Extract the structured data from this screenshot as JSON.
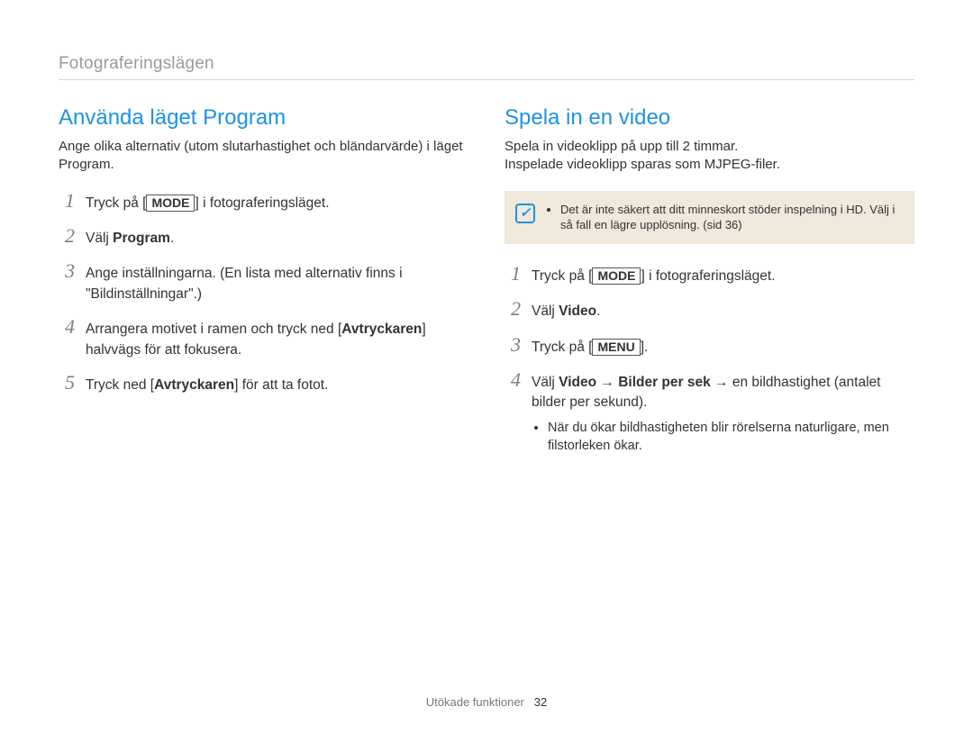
{
  "breadcrumb": "Fotograferingslägen",
  "left": {
    "title": "Använda läget Program",
    "intro": "Ange olika alternativ (utom slutarhastighet och bländarvärde) i läget Program.",
    "steps": [
      {
        "num": "1",
        "pre": "Tryck på [",
        "key": "MODE",
        "post": "] i fotograferingsläget."
      },
      {
        "num": "2",
        "text_pre": "Välj ",
        "bold": "Program",
        "text_post": "."
      },
      {
        "num": "3",
        "text": "Ange inställningarna. (En lista med alternativ finns i \"Bildinställningar\".)"
      },
      {
        "num": "4",
        "text_a": "Arrangera motivet i ramen och tryck ned [",
        "bold": "Avtryckaren",
        "text_b": "] halvvägs för att fokusera."
      },
      {
        "num": "5",
        "text_a": "Tryck ned [",
        "bold": "Avtryckaren",
        "text_b": "] för att ta fotot."
      }
    ]
  },
  "right": {
    "title": "Spela in en video",
    "intro_line1": "Spela in videoklipp på upp till 2 timmar.",
    "intro_line2": "Inspelade videoklipp sparas som MJPEG-filer.",
    "note_icon": "✓",
    "note": "Det är inte säkert att ditt minneskort stöder inspelning i HD. Välj i så fall en lägre upplösning. (sid 36)",
    "steps": [
      {
        "num": "1",
        "pre": "Tryck på [",
        "key": "MODE",
        "post": "] i fotograferingsläget."
      },
      {
        "num": "2",
        "text_pre": "Välj ",
        "bold": "Video",
        "text_post": "."
      },
      {
        "num": "3",
        "pre": "Tryck på [",
        "key": "MENU",
        "post": "]."
      },
      {
        "num": "4",
        "text_pre": "Välj ",
        "bold1": "Video",
        "arrow1": " → ",
        "bold2": "Bilder per sek",
        "arrow2": " → ",
        "tail": "en bildhastighet (antalet bilder per sekund).",
        "sub": "När du ökar bildhastigheten blir rörelserna naturligare, men filstorleken ökar."
      }
    ]
  },
  "footer_label": "Utökade funktioner",
  "footer_page": "32"
}
